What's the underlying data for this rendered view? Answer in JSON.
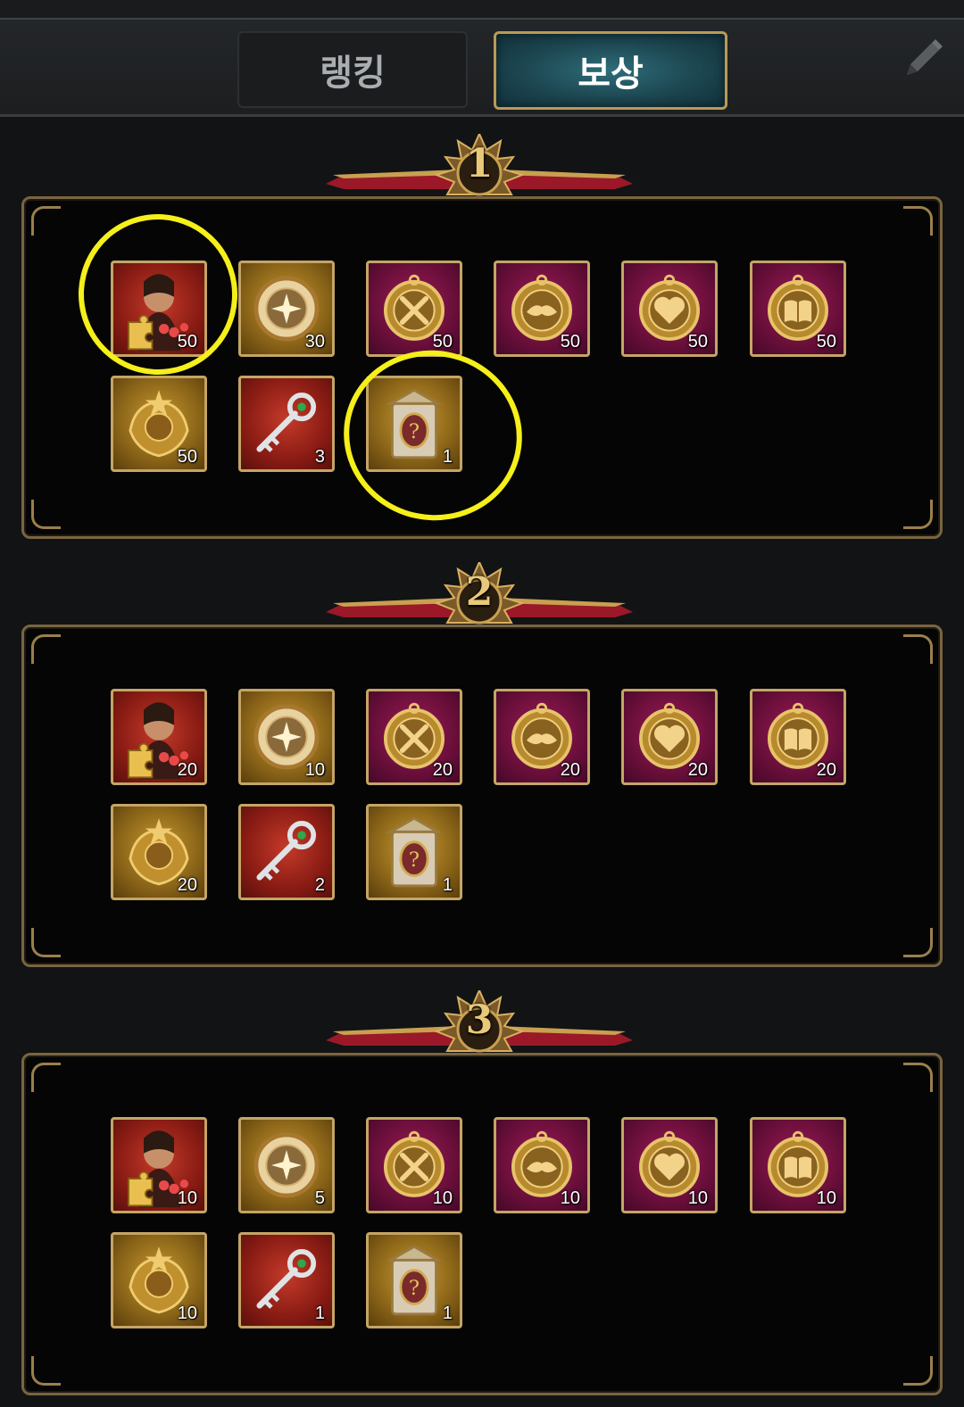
{
  "tabs": {
    "ranking": "랭킹",
    "rewards": "보상",
    "active": "rewards"
  },
  "tiers": [
    {
      "rank": "1",
      "items": [
        {
          "icon": "character-puzzle-icon",
          "bg": "red",
          "count": "50"
        },
        {
          "icon": "compass-medal-icon",
          "bg": "gold",
          "count": "30"
        },
        {
          "icon": "crossed-swords-medal-icon",
          "bg": "purple",
          "count": "50"
        },
        {
          "icon": "handshake-medal-icon",
          "bg": "purple",
          "count": "50"
        },
        {
          "icon": "heart-medal-icon",
          "bg": "purple",
          "count": "50"
        },
        {
          "icon": "book-medal-icon",
          "bg": "purple",
          "count": "50"
        },
        {
          "icon": "crest-emblem-icon",
          "bg": "gold",
          "count": "50"
        },
        {
          "icon": "ornate-key-icon",
          "bg": "red",
          "count": "3"
        },
        {
          "icon": "mystery-chest-icon",
          "bg": "gold",
          "count": "1"
        }
      ]
    },
    {
      "rank": "2",
      "items": [
        {
          "icon": "character-puzzle-icon",
          "bg": "red",
          "count": "20"
        },
        {
          "icon": "compass-medal-icon",
          "bg": "gold",
          "count": "10"
        },
        {
          "icon": "crossed-swords-medal-icon",
          "bg": "purple",
          "count": "20"
        },
        {
          "icon": "handshake-medal-icon",
          "bg": "purple",
          "count": "20"
        },
        {
          "icon": "heart-medal-icon",
          "bg": "purple",
          "count": "20"
        },
        {
          "icon": "book-medal-icon",
          "bg": "purple",
          "count": "20"
        },
        {
          "icon": "crest-emblem-icon",
          "bg": "gold",
          "count": "20"
        },
        {
          "icon": "ornate-key-icon",
          "bg": "red",
          "count": "2"
        },
        {
          "icon": "mystery-chest-icon",
          "bg": "gold",
          "count": "1"
        }
      ]
    },
    {
      "rank": "3",
      "items": [
        {
          "icon": "character-puzzle-icon",
          "bg": "red",
          "count": "10"
        },
        {
          "icon": "compass-medal-icon",
          "bg": "gold",
          "count": "5"
        },
        {
          "icon": "crossed-swords-medal-icon",
          "bg": "purple",
          "count": "10"
        },
        {
          "icon": "handshake-medal-icon",
          "bg": "purple",
          "count": "10"
        },
        {
          "icon": "heart-medal-icon",
          "bg": "purple",
          "count": "10"
        },
        {
          "icon": "book-medal-icon",
          "bg": "purple",
          "count": "10"
        },
        {
          "icon": "crest-emblem-icon",
          "bg": "gold",
          "count": "10"
        },
        {
          "icon": "ornate-key-icon",
          "bg": "red",
          "count": "1"
        },
        {
          "icon": "mystery-chest-icon",
          "bg": "gold",
          "count": "1"
        }
      ]
    }
  ],
  "annotation_color": "#f5ef1a"
}
